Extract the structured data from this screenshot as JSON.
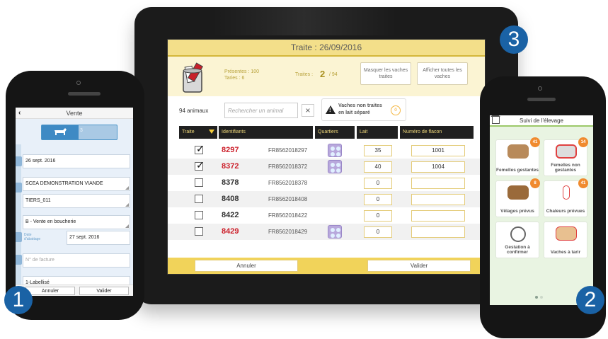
{
  "tablet": {
    "title": "Traite : 26/09/2016",
    "presentes": "Présentes : 100",
    "taries": "Taries : 6",
    "traites_label": "Traites :",
    "traites_count": "2",
    "traites_total": "/ 94",
    "btn_masquer": "Masquer les vaches traites",
    "btn_afficher": "Afficher toutes les vaches",
    "animal_count": "94 animaux",
    "search_placeholder": "Rechercher un animal",
    "clear_symbol": "×",
    "warning_text": "Vaches non traites en lait séparé",
    "warning_count": "0",
    "headers": [
      "Traite",
      "Identifiants",
      "Quartiers",
      "Lait",
      "Numéro de flacon"
    ],
    "rows": [
      {
        "checked": "✓",
        "id": "8297",
        "fr": "FR8562018297",
        "lait": "35",
        "flacon": "1001",
        "id_color": "#cc1f2a"
      },
      {
        "checked": "✓",
        "id": "8372",
        "fr": "FR8562018372",
        "lait": "40",
        "flacon": "1004",
        "id_color": "#cc1f2a"
      },
      {
        "checked": "",
        "id": "8378",
        "fr": "FR8562018378",
        "lait": "0",
        "flacon": "",
        "id_color": "#333333"
      },
      {
        "checked": "",
        "id": "8408",
        "fr": "FR8562018408",
        "lait": "0",
        "flacon": "",
        "id_color": "#333333"
      },
      {
        "checked": "",
        "id": "8422",
        "fr": "FR8562018422",
        "lait": "0",
        "flacon": "",
        "id_color": "#333333"
      },
      {
        "checked": "",
        "id": "8429",
        "fr": "FR8562018429",
        "lait": "0",
        "flacon": "",
        "id_color": "#cc1f2a"
      }
    ],
    "btn_annuler": "Annuler",
    "btn_valider": "Valider"
  },
  "left_phone": {
    "title": "Vente",
    "back_symbol": "‹",
    "tab2_label": "3",
    "date": "26 sept. 2016",
    "client": "SCEA DEMONSTRATION VIANDE",
    "tiers": "TIERS_011",
    "type": "B - Vente en boucherie",
    "date_abattage_label": "Date d'abattage",
    "date_abattage": "27 sept. 2016",
    "facture_placeholder": "N° de facture",
    "label_value": "1-Labellisé",
    "btn_annuler": "Annuler",
    "btn_valider": "Valider"
  },
  "right_phone": {
    "title": "Suivi de l'élevage",
    "tiles": [
      {
        "label": "Femelles gestantes",
        "badge": "41"
      },
      {
        "label": "Femelles non gestantes",
        "badge": "14"
      },
      {
        "label": "Vêlages prévus",
        "badge": "8"
      },
      {
        "label": "Chaleurs prévues",
        "badge": "41"
      },
      {
        "label": "Gestation à confirmer",
        "badge": ""
      },
      {
        "label": "Vaches à tarir",
        "badge": ""
      }
    ]
  },
  "markers": [
    "1",
    "2",
    "3"
  ],
  "colors": {
    "accent_yellow": "#f1d35a",
    "blue": "#1a62a5",
    "red_id": "#cc1f2a",
    "badge_orange": "#f08a2e"
  }
}
